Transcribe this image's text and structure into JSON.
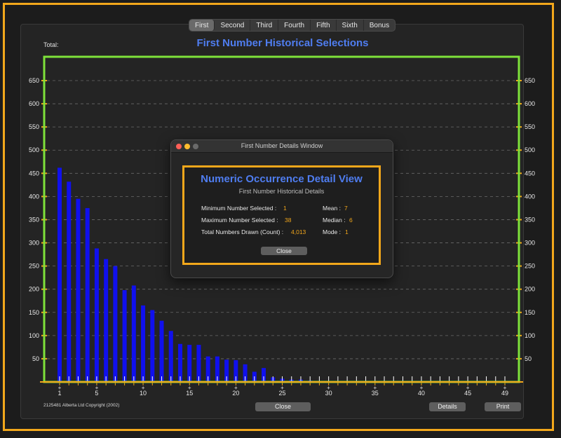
{
  "tabs": [
    "First",
    "Second",
    "Third",
    "Fourth",
    "Fifth",
    "Sixth",
    "Bonus"
  ],
  "active_tab": "First",
  "total_label": "Total:",
  "copyright": "2125481 Alberta Ltd Copyright (2002)",
  "buttons": {
    "close": "Close",
    "details": "Details",
    "print": "Print"
  },
  "colors": {
    "accent_orange": "#f2a71b",
    "axis_green": "#7ee23a",
    "bar_blue": "#1010ee",
    "title_blue": "#4f7df0"
  },
  "chart_data": {
    "type": "bar",
    "title": "First Number Historical Selections",
    "x": [
      1,
      2,
      3,
      4,
      5,
      6,
      7,
      8,
      9,
      10,
      11,
      12,
      13,
      14,
      15,
      16,
      17,
      18,
      19,
      20,
      21,
      22,
      23,
      24,
      25,
      26,
      27,
      28,
      29,
      30,
      31,
      32,
      33,
      34,
      35,
      36,
      37,
      38,
      39,
      40,
      41,
      42,
      43,
      44,
      45,
      46,
      47,
      48,
      49
    ],
    "values": [
      462,
      432,
      395,
      375,
      288,
      265,
      250,
      198,
      208,
      165,
      155,
      132,
      110,
      82,
      80,
      80,
      55,
      55,
      48,
      47,
      38,
      22,
      30,
      10,
      7,
      5,
      5,
      3,
      2,
      1,
      1,
      1,
      1,
      0,
      0,
      0,
      0,
      1,
      0,
      0,
      0,
      0,
      0,
      0,
      0,
      0,
      0,
      0,
      0
    ],
    "x_ticks": [
      1,
      5,
      10,
      15,
      20,
      25,
      30,
      35,
      40,
      45,
      49
    ],
    "y_ticks": [
      50,
      100,
      150,
      200,
      250,
      300,
      350,
      400,
      450,
      500,
      550,
      600,
      650
    ],
    "ylim": [
      0,
      650
    ],
    "grid": true
  },
  "dialog": {
    "window_title": "First Number Details Window",
    "heading": "Numeric Occurrence Detail View",
    "subtitle": "First Number Historical Details",
    "stats_left": [
      {
        "label": "Minimum Number Selected :",
        "value": "1"
      },
      {
        "label": "Maximum Number Selected :",
        "value": "38"
      },
      {
        "label": "Total Numbers Drawn (Count) :",
        "value": "4,013"
      }
    ],
    "stats_right": [
      {
        "label": "Mean :",
        "value": "7"
      },
      {
        "label": "Median :",
        "value": "6"
      },
      {
        "label": "Mode :",
        "value": "1"
      }
    ],
    "close_label": "Close"
  }
}
